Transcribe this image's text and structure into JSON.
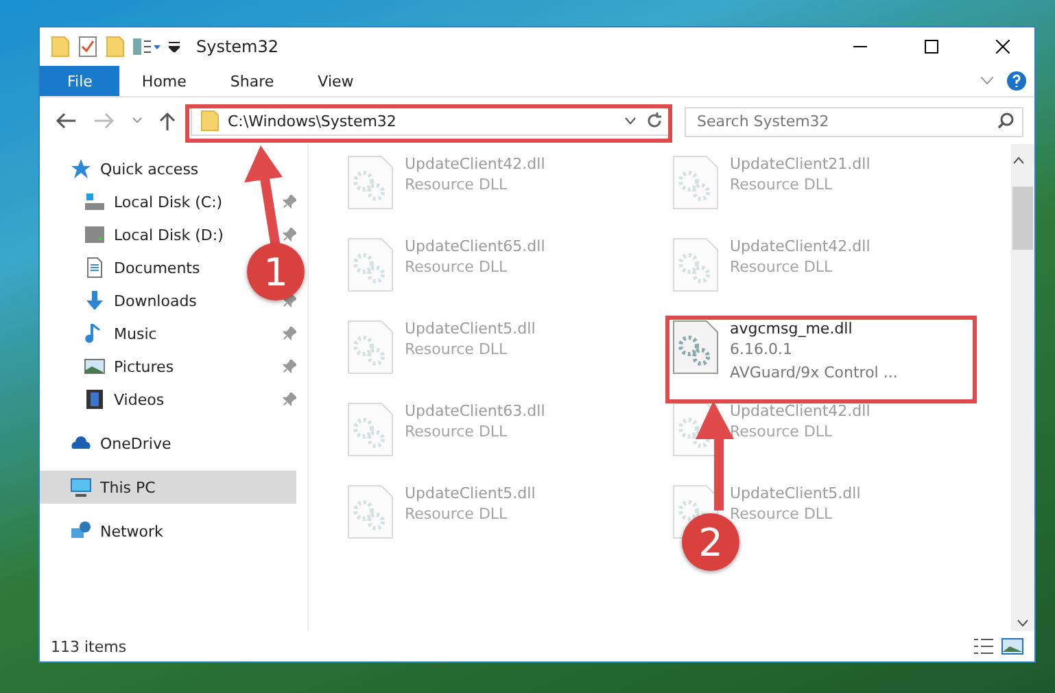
{
  "window": {
    "title": "System32"
  },
  "ribbon": {
    "tabs": [
      {
        "label": "File",
        "kind": "menu"
      },
      {
        "label": "Home",
        "kind": "tab"
      },
      {
        "label": "Share",
        "kind": "tab"
      },
      {
        "label": "View",
        "kind": "tab"
      }
    ]
  },
  "address": {
    "path": "C:\\Windows\\System32"
  },
  "search": {
    "placeholder": "Search System32"
  },
  "nav": {
    "items": [
      {
        "label": "Quick access",
        "selected": false,
        "children": [
          {
            "label": "Local Disk (C:)",
            "pinned": true,
            "selected": false
          },
          {
            "label": "Local Disk (D:)",
            "pinned": true,
            "selected": false
          },
          {
            "label": "Documents",
            "pinned": false,
            "selected": false
          },
          {
            "label": "Downloads",
            "pinned": true,
            "selected": false
          },
          {
            "label": "Music",
            "pinned": true,
            "selected": false
          },
          {
            "label": "Pictures",
            "pinned": true,
            "selected": false
          },
          {
            "label": "Videos",
            "pinned": true,
            "selected": false
          }
        ]
      },
      {
        "label": "OneDrive",
        "selected": false
      },
      {
        "label": "This PC",
        "selected": true
      },
      {
        "label": "Network",
        "selected": false
      }
    ]
  },
  "files": [
    {
      "name": "UpdateClient42.dll",
      "lines": [
        "Resource DLL"
      ],
      "dimmed": true
    },
    {
      "name": "UpdateClient21.dll",
      "lines": [
        "Resource DLL"
      ],
      "dimmed": true
    },
    {
      "name": "UpdateClient65.dll",
      "lines": [
        "Resource DLL"
      ],
      "dimmed": true
    },
    {
      "name": "UpdateClient42.dll",
      "lines": [
        "Resource DLL"
      ],
      "dimmed": true
    },
    {
      "name": "UpdateClient5.dll",
      "lines": [
        "Resource DLL"
      ],
      "dimmed": true
    },
    {
      "name": "avgcmsg_me.dll",
      "lines": [
        "6.16.0.1",
        "AVGuard/9x Control ..."
      ],
      "dimmed": false
    },
    {
      "name": "UpdateClient63.dll",
      "lines": [
        "Resource DLL"
      ],
      "dimmed": true
    },
    {
      "name": "UpdateClient42.dll",
      "lines": [
        "Resource DLL"
      ],
      "dimmed": true
    },
    {
      "name": "UpdateClient5.dll",
      "lines": [
        "Resource DLL"
      ],
      "dimmed": true
    },
    {
      "name": "UpdateClient5.dll",
      "lines": [
        "Resource DLL"
      ],
      "dimmed": true
    }
  ],
  "status_bar": {
    "count": "113 items"
  },
  "annotations": [
    {
      "number": "1"
    },
    {
      "number": "2"
    }
  ]
}
